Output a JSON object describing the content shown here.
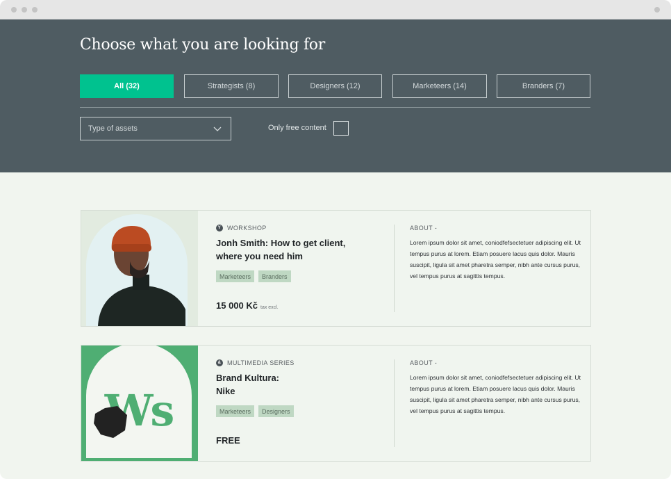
{
  "hero": {
    "title": "Choose what you are looking for",
    "tabs": [
      {
        "label": "All (32)",
        "active": true
      },
      {
        "label": "Strategists (8)",
        "active": false
      },
      {
        "label": "Designers (12)",
        "active": false
      },
      {
        "label": "Marketeers (14)",
        "active": false
      },
      {
        "label": "Branders (7)",
        "active": false
      }
    ],
    "asset_select": {
      "value": "Type of assets",
      "icon": "chevron-down-icon"
    },
    "free_filter": {
      "label": "Only free content",
      "checked": false
    }
  },
  "cards": [
    {
      "type_icon_glyph": "Y",
      "type": "WORKSHOP",
      "title": "Jonh Smith: How to get client, where you need him",
      "tags": [
        "Marketeers",
        "Branders"
      ],
      "price": "15 000 Kč",
      "price_note": "tax excl.",
      "about_label": "ABOUT -",
      "about_text": "Lorem ipsum dolor sit amet, coniodfefsectetuer adipiscing elit. Ut tempus purus at lorem. Etiam posuere lacus quis dolor. Mauris suscipit, ligula sit amet pharetra semper, nibh ante cursus purus, vel tempus purus at sagittis tempus."
    },
    {
      "type_icon_glyph": "&",
      "type": "MULTIMEDIA SERIES",
      "title": "Brand Kultura: Nike",
      "logo_text": "Ws",
      "tags": [
        "Marketeers",
        "Designers"
      ],
      "price": "FREE",
      "about_label": "ABOUT -",
      "about_text": "Lorem ipsum dolor sit amet, coniodfefsectetuer adipiscing elit. Ut tempus purus at lorem. Etiam posuere lacus quis dolor. Mauris suscipit, ligula sit amet pharetra semper, nibh ante cursus purus, vel tempus purus at sagittis tempus."
    }
  ],
  "colors": {
    "hero_bg": "#4f5c62",
    "accent": "#00c28f",
    "page_bg": "#f1f5ef",
    "tag_bg": "#bfd8c3",
    "brand_green": "#4fae73"
  }
}
